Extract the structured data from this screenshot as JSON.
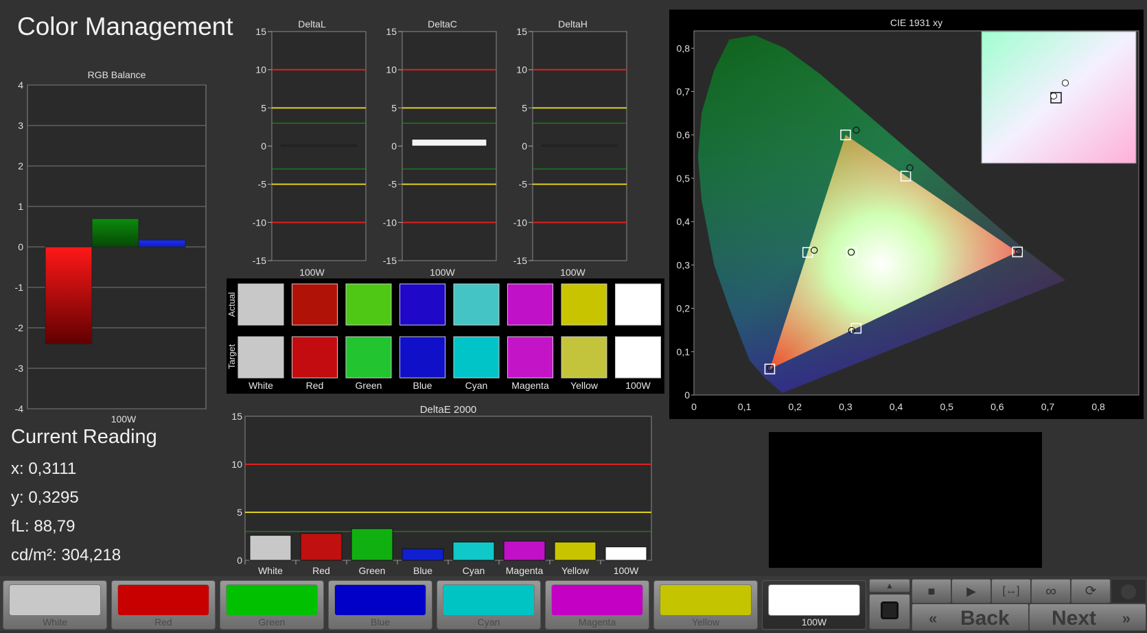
{
  "app": {
    "title": "Color Management"
  },
  "rgb_balance": {
    "title": "RGB Balance",
    "y_ticks": [
      "4",
      "3",
      "2",
      "1",
      "0",
      "-1",
      "-2",
      "-3",
      "-4"
    ],
    "x_label": "100W",
    "colors": {
      "red": "#ff1010",
      "green": "#10a010",
      "blue": "#1020e0"
    }
  },
  "delta_charts": [
    {
      "title": "DeltaL",
      "x_label": "100W",
      "value": 0.1
    },
    {
      "title": "DeltaC",
      "x_label": "100W",
      "value": 0.9
    },
    {
      "title": "DeltaH",
      "x_label": "100W",
      "value": 0.1
    }
  ],
  "delta_y_ticks": [
    "15",
    "10",
    "5",
    "0",
    "-5",
    "-10",
    "-15"
  ],
  "swatches": {
    "actual_label": "Actual",
    "target_label": "Target",
    "items": [
      {
        "name": "White",
        "actual": "#c8c8c8",
        "target": "#c8c8c8"
      },
      {
        "name": "Red",
        "actual": "#b01208",
        "target": "#c20c10"
      },
      {
        "name": "Green",
        "actual": "#4ec814",
        "target": "#22c430"
      },
      {
        "name": "Blue",
        "actual": "#2008c8",
        "target": "#1010c8"
      },
      {
        "name": "Cyan",
        "actual": "#44c4c4",
        "target": "#00c4c8"
      },
      {
        "name": "Magenta",
        "actual": "#c010c8",
        "target": "#c414c8"
      },
      {
        "name": "Yellow",
        "actual": "#c8c400",
        "target": "#c4c43c"
      },
      {
        "name": "100W",
        "actual": "#ffffff",
        "target": "#ffffff"
      }
    ]
  },
  "deltae": {
    "title": "DeltaE 2000",
    "y_ticks": [
      "15",
      "10",
      "5",
      "0"
    ]
  },
  "cie": {
    "title": "CIE 1931 xy",
    "x_ticks": [
      "0",
      "0,1",
      "0,2",
      "0,3",
      "0,4",
      "0,5",
      "0,6",
      "0,7",
      "0,8"
    ],
    "y_ticks": [
      "0",
      "0,1",
      "0,2",
      "0,3",
      "0,4",
      "0,5",
      "0,6",
      "0,7",
      "0,8"
    ]
  },
  "current_reading": {
    "title": "Current Reading",
    "x": "x: 0,3111",
    "y": "y: 0,3295",
    "fl": "fL: 88,79",
    "cdm2": "cd/m²: 304,218"
  },
  "chart_data": [
    {
      "type": "bar",
      "title": "RGB Balance",
      "categories": [
        "100W"
      ],
      "series": [
        {
          "name": "Red",
          "values": [
            -2.4
          ]
        },
        {
          "name": "Green",
          "values": [
            0.7
          ]
        },
        {
          "name": "Blue",
          "values": [
            0.17
          ]
        }
      ],
      "ylim": [
        -4,
        4
      ],
      "xlabel": "100W"
    },
    {
      "type": "bar",
      "title": "DeltaL",
      "categories": [
        "100W"
      ],
      "values": [
        0.1
      ],
      "ylim": [
        -15,
        15
      ],
      "reference_lines": [
        10,
        5,
        3,
        -3,
        -5,
        -10
      ]
    },
    {
      "type": "bar",
      "title": "DeltaC",
      "categories": [
        "100W"
      ],
      "values": [
        0.9
      ],
      "ylim": [
        -15,
        15
      ],
      "reference_lines": [
        10,
        5,
        3,
        -3,
        -5,
        -10
      ]
    },
    {
      "type": "bar",
      "title": "DeltaH",
      "categories": [
        "100W"
      ],
      "values": [
        0.1
      ],
      "ylim": [
        -15,
        15
      ],
      "reference_lines": [
        10,
        5,
        3,
        -3,
        -5,
        -10
      ]
    },
    {
      "type": "bar",
      "title": "DeltaE 2000",
      "categories": [
        "White",
        "Red",
        "Green",
        "Blue",
        "Cyan",
        "Magenta",
        "Yellow",
        "100W"
      ],
      "values": [
        2.6,
        2.8,
        3.3,
        1.2,
        1.9,
        2.0,
        1.9,
        1.4
      ],
      "colors": [
        "#c8c8c8",
        "#c01010",
        "#10b010",
        "#1020d0",
        "#10c8c8",
        "#c010c8",
        "#c8c400",
        "#ffffff"
      ],
      "ylim": [
        0,
        15
      ],
      "reference_lines": [
        10,
        5,
        3
      ]
    },
    {
      "type": "scatter",
      "title": "CIE 1931 xy",
      "xlim": [
        0,
        0.8
      ],
      "ylim": [
        0,
        0.8
      ],
      "targets": [
        {
          "name": "Red",
          "x": 0.64,
          "y": 0.33
        },
        {
          "name": "Green",
          "x": 0.3,
          "y": 0.6
        },
        {
          "name": "Blue",
          "x": 0.15,
          "y": 0.06
        },
        {
          "name": "Cyan",
          "x": 0.225,
          "y": 0.329
        },
        {
          "name": "Magenta",
          "x": 0.321,
          "y": 0.154
        },
        {
          "name": "Yellow",
          "x": 0.419,
          "y": 0.505
        },
        {
          "name": "White",
          "x": 0.3127,
          "y": 0.329
        }
      ],
      "measured": [
        {
          "name": "Red",
          "x": 0.642,
          "y": 0.331
        },
        {
          "name": "Green",
          "x": 0.321,
          "y": 0.611
        },
        {
          "name": "Blue",
          "x": 0.151,
          "y": 0.062
        },
        {
          "name": "Cyan",
          "x": 0.238,
          "y": 0.334
        },
        {
          "name": "Magenta",
          "x": 0.312,
          "y": 0.149
        },
        {
          "name": "Yellow",
          "x": 0.427,
          "y": 0.524
        },
        {
          "name": "White",
          "x": 0.3111,
          "y": 0.3295
        }
      ]
    }
  ],
  "bottom": {
    "buttons": [
      {
        "label": "White",
        "color": "#c8c8c8"
      },
      {
        "label": "Red",
        "color": "#c80000"
      },
      {
        "label": "Green",
        "color": "#00c000"
      },
      {
        "label": "Blue",
        "color": "#0000c8"
      },
      {
        "label": "Cyan",
        "color": "#00c4c4"
      },
      {
        "label": "Magenta",
        "color": "#c400c4"
      },
      {
        "label": "Yellow",
        "color": "#c4c400"
      },
      {
        "label": "100W",
        "color": "#ffffff"
      }
    ],
    "back_label": "Back",
    "next_label": "Next"
  }
}
